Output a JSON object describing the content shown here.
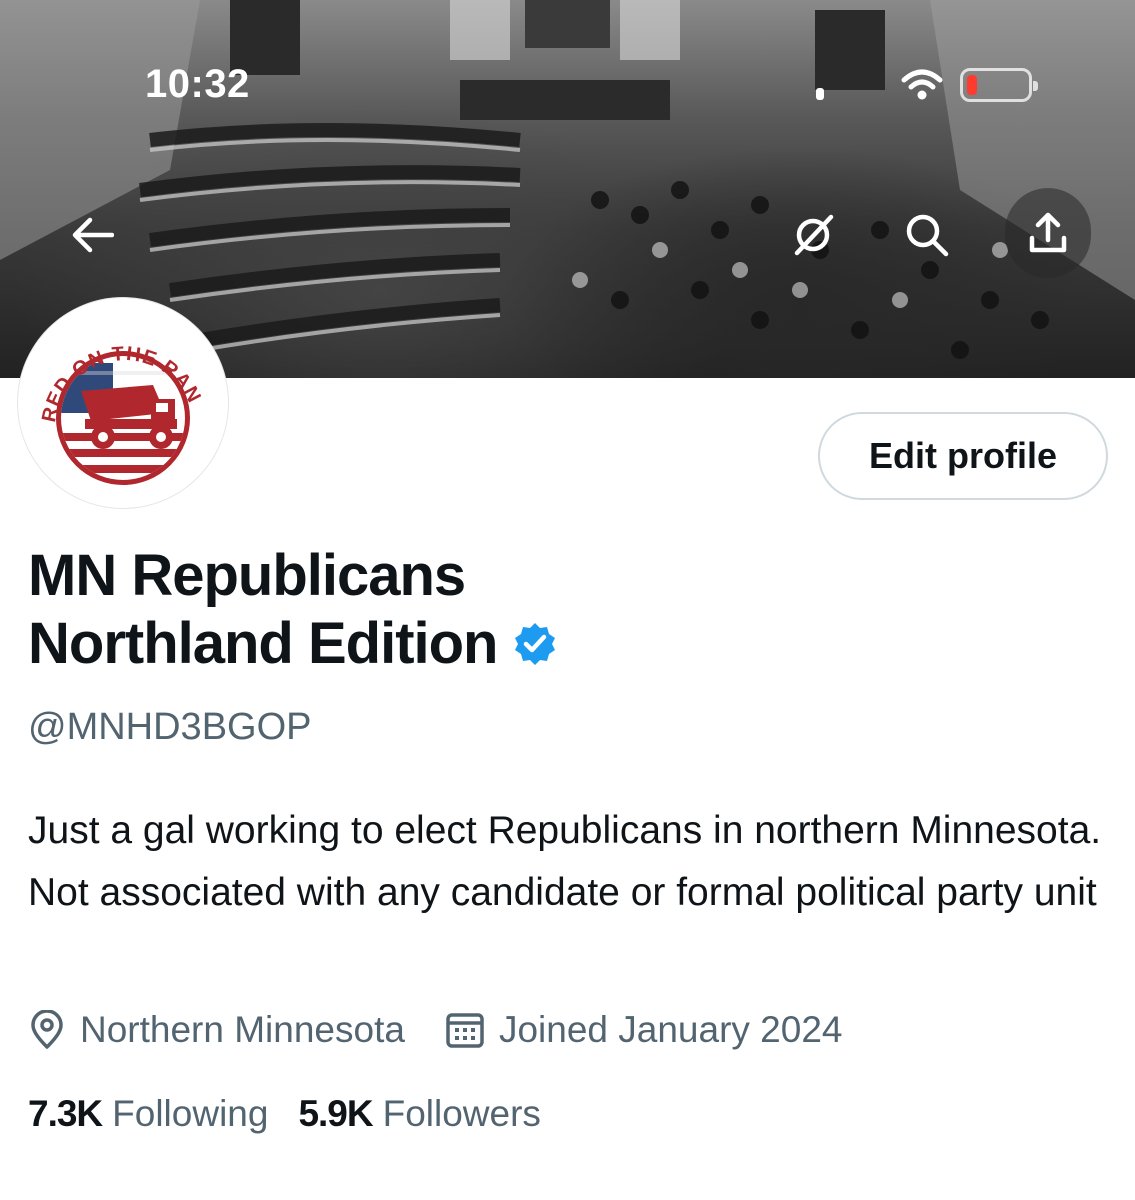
{
  "status_bar": {
    "time": "10:32",
    "battery_color": "#ff3b30"
  },
  "header": {
    "back_icon": "arrow-left-icon",
    "grok_icon": "grok-icon",
    "search_icon": "search-icon",
    "share_icon": "share-icon"
  },
  "avatar": {
    "logo_text": "RED ON THE RANGE",
    "colors": {
      "red": "#b0282d",
      "blue": "#2f4a7a"
    }
  },
  "edit_profile_label": "Edit profile",
  "profile": {
    "name_line1": "MN Republicans",
    "name_line2": "Northland Edition",
    "verified_color": "#1d9bf0",
    "handle": "@MNHD3BGOP",
    "bio": "Just a gal working to elect Republicans in northern Minnesota. Not associated with any candidate or formal political party unit",
    "location": "Northern Minnesota",
    "joined": "Joined January 2024",
    "following_count": "7.3K",
    "following_label": "Following",
    "followers_count": "5.9K",
    "followers_label": "Followers"
  },
  "colors": {
    "text": "#0f1419",
    "secondary": "#536471",
    "border": "#cfd9de"
  }
}
